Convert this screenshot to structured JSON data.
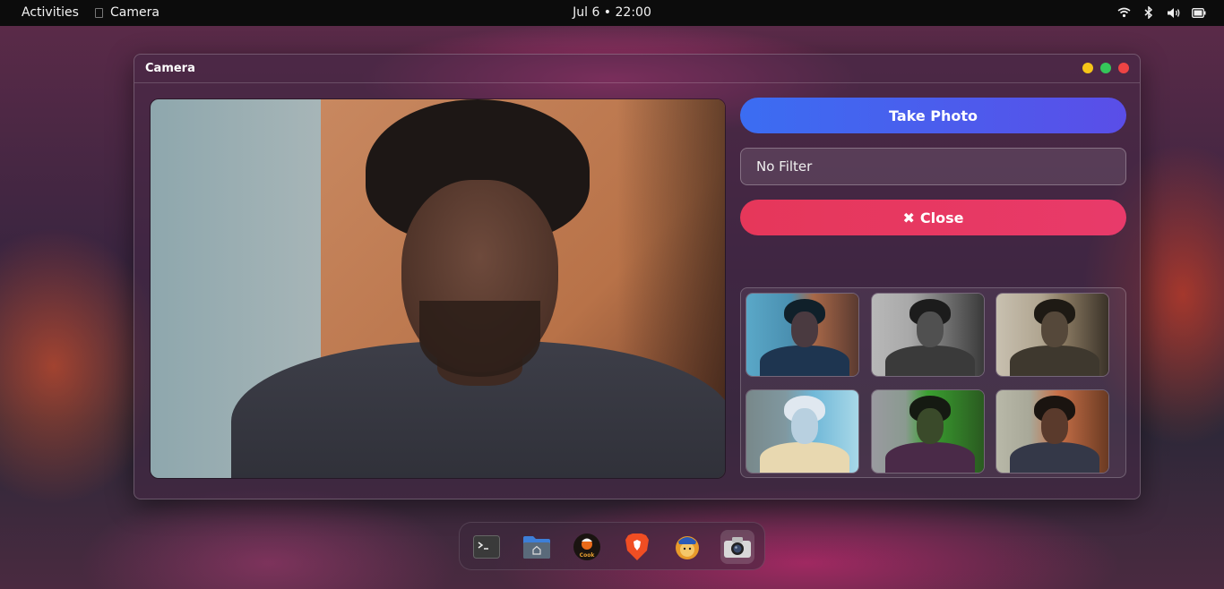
{
  "topbar": {
    "activities": "Activities",
    "app_name": "Camera",
    "clock": "Jul 6 • 22:00",
    "tray_icons": [
      "wifi-icon",
      "bluetooth-icon",
      "volume-icon",
      "battery-icon"
    ]
  },
  "window": {
    "title": "Camera",
    "controls": {
      "minimize_color": "#f5c518",
      "maximize_color": "#35c65a",
      "close_color": "#ee4444"
    }
  },
  "controls": {
    "take_photo": "Take Photo",
    "filter_selected": "No Filter",
    "close_icon": "✖",
    "close_label": "Close"
  },
  "filters": [
    {
      "name": "cool-filter",
      "tint": "#3a7fa8"
    },
    {
      "name": "grayscale-filter",
      "tint": "#8a8a8a"
    },
    {
      "name": "sepia-filter",
      "tint": "#8a7a66"
    },
    {
      "name": "invert-filter",
      "tint": "#a8c8d8"
    },
    {
      "name": "green-filter",
      "tint": "#3c9a34"
    },
    {
      "name": "warm-filter",
      "tint": "#a8663a"
    }
  ],
  "dock": {
    "items": [
      "terminal-icon",
      "files-home-icon",
      "cook-app-icon",
      "brave-browser-icon",
      "lion-app-icon",
      "camera-app-icon"
    ]
  },
  "colors": {
    "take_photo_start": "#3b6df2",
    "take_photo_end": "#5a4ee8",
    "close_start": "#e6375a",
    "close_end": "#e83a6a"
  }
}
